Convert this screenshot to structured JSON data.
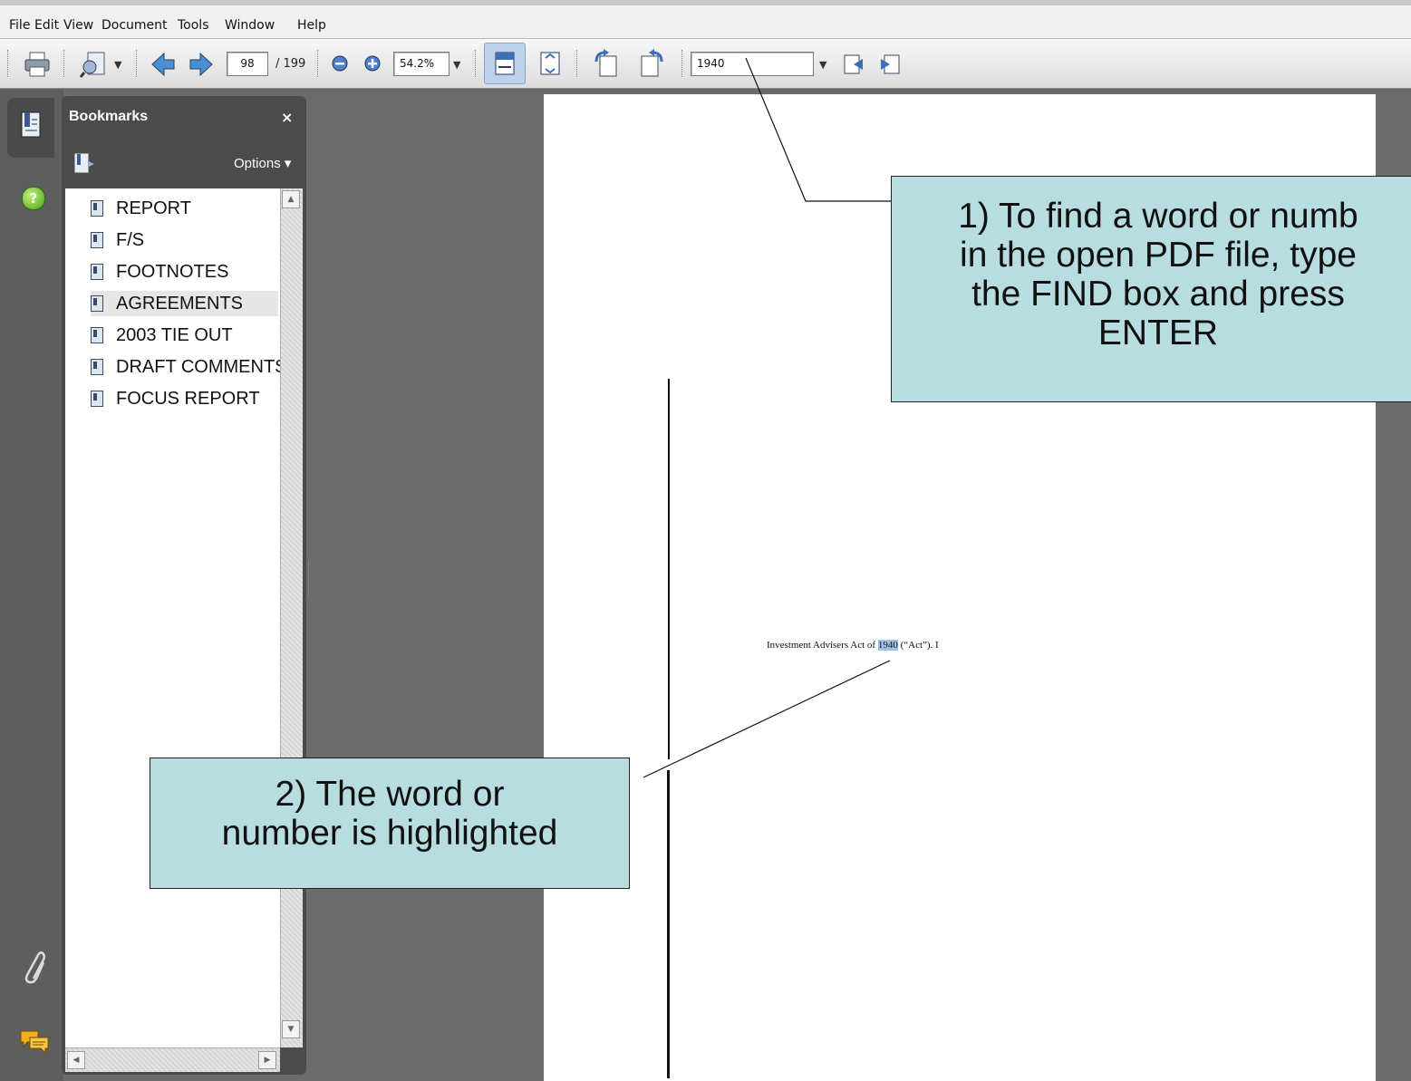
{
  "menu": [
    "File",
    "Edit",
    "View",
    "Document",
    "Tools",
    "Window",
    "Help"
  ],
  "toolbar": {
    "page_current": "98",
    "page_total": "/ 199",
    "zoom": "54.2%",
    "find_value": "1940"
  },
  "bookmarks_panel": {
    "title": "Bookmarks",
    "close": "×",
    "options": "Options ▾",
    "items": [
      "REPORT",
      "F/S",
      "FOOTNOTES",
      "AGREEMENTS",
      "2003 TIE OUT",
      "DRAFT COMMENTS",
      "FOCUS REPORT"
    ],
    "selected": "AGREEMENTS"
  },
  "document": {
    "text_before": "Investment Advisers Act of ",
    "highlight": "1940",
    "text_after": " (“Act”). I"
  },
  "callouts": {
    "find_line1": "1) To find a word or numb",
    "find_line2": "in the open PDF file, type",
    "find_line3": "the FIND box and press",
    "find_line4": "ENTER",
    "highlight_line1": "2) The word or",
    "highlight_line2": "number is highlighted"
  },
  "colors": {
    "callout_bg": "#b7dde1",
    "highlight": "#9fc3e6",
    "canvas_bg": "#6b6b6b"
  }
}
